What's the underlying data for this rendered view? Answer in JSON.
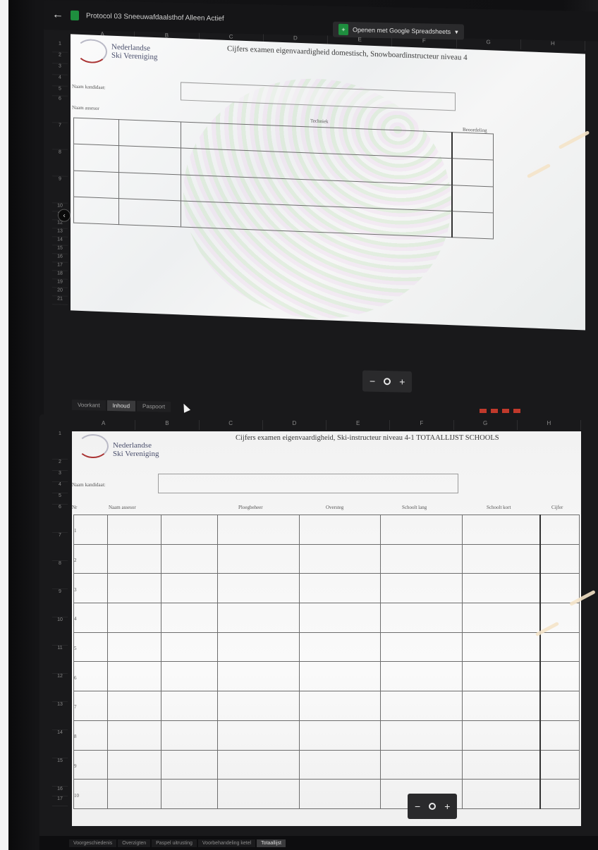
{
  "top_screen": {
    "doc_title": "Protocol 03 Sneeuwafdaalsthof Alleen Actief",
    "open_button_label": "Openen met Google Spreadsheets",
    "columns": [
      "A",
      "B",
      "C",
      "D",
      "E",
      "F",
      "G",
      "H"
    ],
    "rows": [
      "1",
      "2",
      "3",
      "4",
      "5",
      "6",
      "7",
      "8",
      "9",
      "10",
      "11",
      "12",
      "13",
      "14",
      "15",
      "16",
      "17",
      "18",
      "19",
      "20",
      "21"
    ],
    "org_name_line1": "Nederlandse",
    "org_name_line2": "Ski Vereniging",
    "sheet_title": "Cijfers examen eigenvaardigheid domestisch, Snowboardinstructeur niveau 4",
    "label_candidate": "Naam kandidaat:",
    "label_assessor": "Naam assesor",
    "header_techniek": "Techniek",
    "header_beoordeling": "Beoordeling",
    "tabs": [
      "Voorkant",
      "Inhoud",
      "Paspoort"
    ],
    "active_tab": "Inhoud"
  },
  "bottom_screen": {
    "columns": [
      "A",
      "B",
      "C",
      "D",
      "E",
      "F",
      "G",
      "H"
    ],
    "rows": [
      "1",
      "2",
      "3",
      "4",
      "5",
      "6",
      "7",
      "8",
      "9",
      "10",
      "11",
      "12",
      "13",
      "14",
      "15",
      "16",
      "17"
    ],
    "org_name_line1": "Nederlandse",
    "org_name_line2": "Ski Vereniging",
    "sheet_title": "Cijfers examen eigenvaardigheid, Ski-instructeur niveau 4-1 TOTAALLIJST SCHOOLS",
    "label_candidate": "Naam kandidaat:",
    "headers": {
      "nr": "Nr",
      "naam_assesor": "Naam assesor",
      "ploegbeheer": "Ploegbeheer",
      "oversteg": "Oversteg",
      "schoolstraat_lang": "Schoolt lang",
      "schoolstraat_kort": "Schoolt kort",
      "cijfer": "Cijfer"
    },
    "row_numbers": [
      "1",
      "2",
      "3",
      "4",
      "5",
      "6",
      "7",
      "8",
      "9",
      "10"
    ],
    "tabs": [
      "Voorgeschiedenis",
      "Overzigten",
      "Paspel uitrusting",
      "Voorbehandeling ketel",
      "Totaallijst"
    ],
    "active_tab": "Totaallijst"
  },
  "zoom_controls": {
    "minus": "−",
    "plus": "+"
  },
  "icons": {
    "back": "back-arrow-icon",
    "sheets": "sheets-logo-icon",
    "zoom_in": "plus-icon",
    "zoom_out": "minus-icon",
    "search": "magnifier-icon",
    "sidebar": "chevron-left-icon"
  }
}
